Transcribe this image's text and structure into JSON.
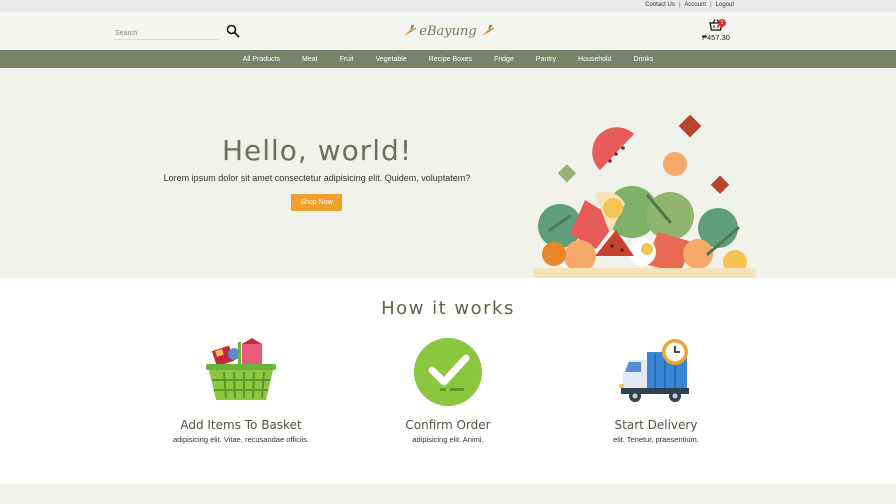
{
  "topbar": {
    "links": [
      "Contact Us",
      "Account",
      "Logout"
    ],
    "separator": "|"
  },
  "header": {
    "search_placeholder": "Search",
    "logo_text": "eBayung",
    "cart_count": "1",
    "cart_total": "₱457.30"
  },
  "nav": {
    "items": [
      "All Products",
      "Meat",
      "Fruit",
      "Vegetable",
      "Recipe Boxes",
      "Fridge",
      "Pantry",
      "Household",
      "Drinks"
    ]
  },
  "hero": {
    "title": "Hello, world!",
    "subtitle": "Lorem ipsum dolor sit amet consectetur adipisicing elit. Quidem, voluptatem?",
    "button_label": "Shop Now"
  },
  "how": {
    "title": "How it works",
    "steps": [
      {
        "title": "Add Items To Basket",
        "text": "adipisicing elit. Vitae, recusandae officiis.",
        "icon": "basket-icon"
      },
      {
        "title": "Confirm Order",
        "text": "adipisicing elit. Animi.",
        "icon": "check-circle-icon"
      },
      {
        "title": "Start Delivery",
        "text": "elit. Tenetur, praesentium.",
        "icon": "delivery-truck-icon"
      }
    ]
  },
  "colors": {
    "accent": "#f0a02c",
    "nav_bg": "#7a8268",
    "hero_bg": "#f1f1ec",
    "badge": "#e02b2b"
  }
}
